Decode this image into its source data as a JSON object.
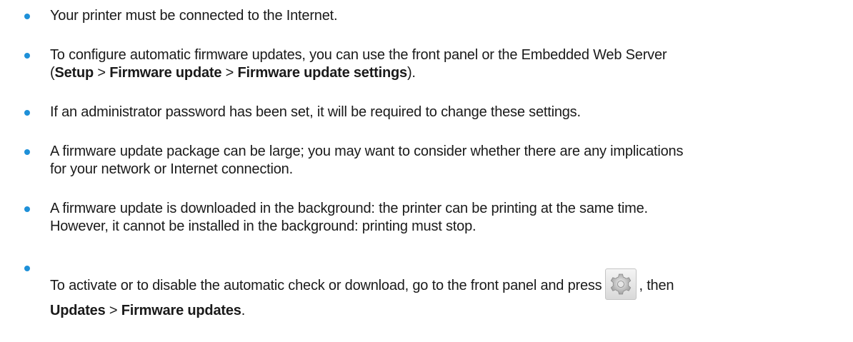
{
  "items": [
    {
      "text": "Your printer must be connected to the Internet."
    },
    {
      "line1": "To configure automatic firmware updates, you can use the front panel or the Embedded Web Server",
      "open": "(",
      "p1": "Setup",
      "sep1": " > ",
      "p2": "Firmware update",
      "sep2": " > ",
      "p3": "Firmware update settings",
      "close": ")."
    },
    {
      "text": "If an administrator password has been set, it will be required to change these settings."
    },
    {
      "line1": "A firmware update package can be large; you may want to consider whether there are any implications",
      "line2": "for your network or Internet connection."
    },
    {
      "line1": "A firmware update is downloaded in the background: the printer can be printing at the same time.",
      "line2": "However, it cannot be installed in the background: printing must stop."
    },
    {
      "before": "To activate or to disable the automatic check or download, go to the front panel and press",
      "after": ", then",
      "p1": "Updates",
      "sep": " > ",
      "p2": "Firmware updates",
      "end": ".",
      "icon": "settings-gear-icon"
    }
  ],
  "colors": {
    "bullet": "#1e90d8",
    "text": "#1a1a1a"
  }
}
